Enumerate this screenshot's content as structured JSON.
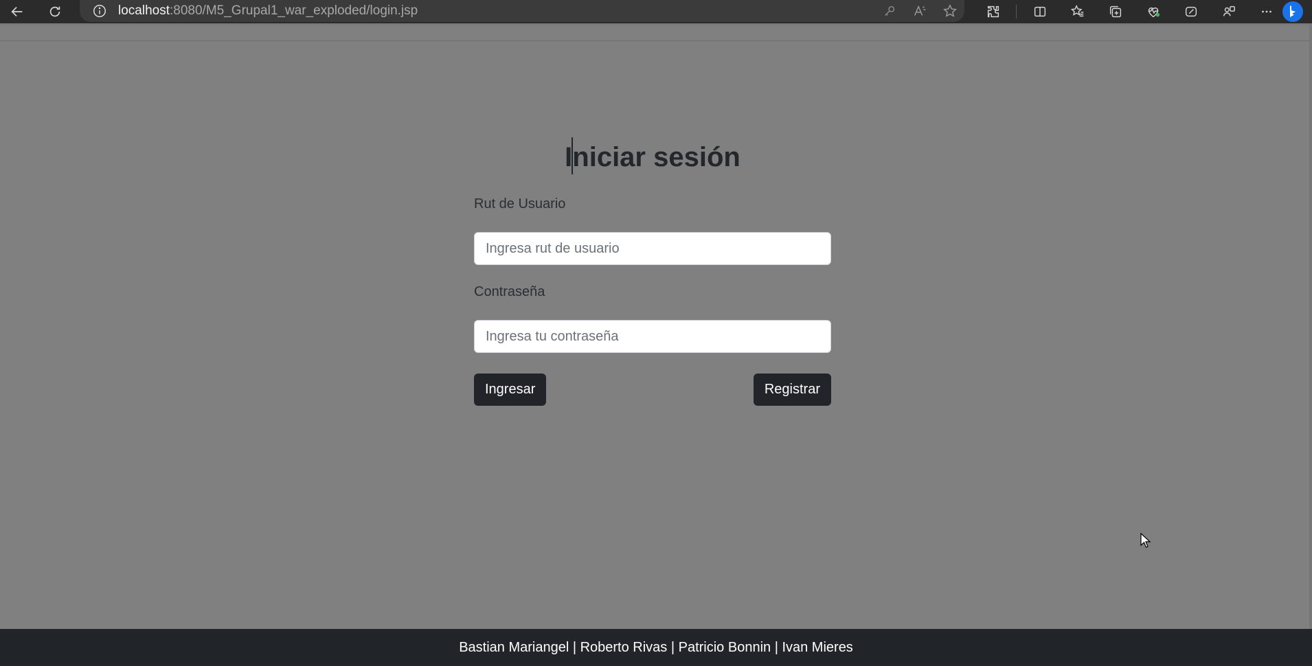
{
  "browser": {
    "url_host": "localhost",
    "url_rest": ":8080/M5_Grupal1_war_exploded/login.jsp",
    "icons": [
      "back-icon",
      "refresh-icon",
      "info-icon",
      "key-icon",
      "read-aloud-icon",
      "favorite-star-icon",
      "extensions-icon",
      "split-screen-icon",
      "favorites-icon",
      "collections-icon",
      "browser-essentials-icon",
      "copilot-icon",
      "sidebar-icon",
      "more-icon",
      "bing-icon"
    ]
  },
  "login": {
    "title": "Iniciar sesión",
    "rut_label": "Rut de Usuario",
    "rut_placeholder": "Ingresa rut de usuario",
    "password_label": "Contraseña",
    "password_placeholder": "Ingresa tu contraseña",
    "submit_label": "Ingresar",
    "register_label": "Registrar"
  },
  "footer": {
    "text": "Bastian Mariangel | Roberto Rivas | Patricio Bonnin | Ivan Mieres"
  },
  "colors": {
    "page_bg": "#808080",
    "dark": "#212529",
    "browser_bar": "#2b2b2b",
    "accent_bing": "#1a73e8"
  }
}
